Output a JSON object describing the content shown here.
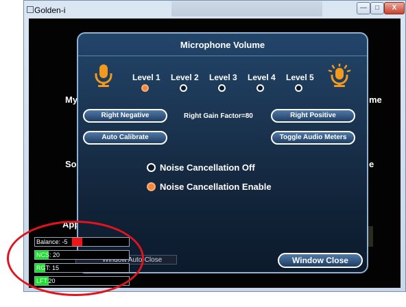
{
  "window": {
    "title": "Golden-i",
    "blurred_text": "...",
    "min_label": "—",
    "max_label": "□",
    "close_label": "X"
  },
  "background_app": {
    "left_text_1": "My",
    "left_text_2": "So",
    "left_text_3": "App",
    "right_text_1": "me",
    "right_text_2": "e",
    "window_auto_close": "Window Auto-Close"
  },
  "dialog": {
    "title": "Microphone Volume",
    "levels": [
      {
        "label": "Level 1",
        "selected": true
      },
      {
        "label": "Level 2",
        "selected": false
      },
      {
        "label": "Level 3",
        "selected": false
      },
      {
        "label": "Level 4",
        "selected": false
      },
      {
        "label": "Level 5",
        "selected": false
      }
    ],
    "mic_left_icon": "microphone-low-icon",
    "mic_right_icon": "microphone-high-icon",
    "right_negative": "Right Negative",
    "right_gain_factor": "Right Gain Factor=80",
    "right_positive": "Right Positive",
    "auto_calibrate": "Auto Calibrate",
    "toggle_audio_meters": "Toggle Audio Meters",
    "noise_off": "Noise Cancellation Off",
    "noise_enable": "Noise Cancellation Enable",
    "noise_selected": "enable",
    "window_close": "Window Close"
  },
  "meters": {
    "balance": {
      "label": "Balance: -5",
      "value": -5
    },
    "ncs": {
      "label": "NCS:",
      "value": "20"
    },
    "rgt": {
      "label": "RGT:",
      "value": "15"
    },
    "lft": {
      "label": "LFT:",
      "value": "20"
    }
  },
  "colors": {
    "accent_orange": "#f2883e",
    "meter_green": "#19e02b",
    "meter_red": "#f21515",
    "annotation_red": "#e2131d",
    "dialog_border": "#8fb3d6"
  }
}
